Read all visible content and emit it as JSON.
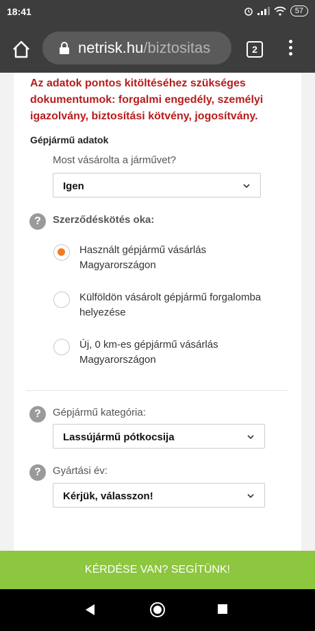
{
  "status_bar": {
    "time": "18:41",
    "battery": "57"
  },
  "browser": {
    "url_domain": "netrisk.hu",
    "url_path": "/biztositas",
    "tab_count": "2"
  },
  "notice": "Az adatok pontos kitöltéséhez szükséges dokumentumok: forgalmi engedély, személyi igazolvány, biztosítási kötvény, jogosítvány.",
  "section_title": "Gépjármű adatok",
  "purchase_question": {
    "label": "Most vásárolta a járművet?",
    "value": "Igen"
  },
  "contract_reason": {
    "label": "Szerződéskötés oka:",
    "options": [
      {
        "label": "Használt gépjármű vásárlás Magyarországon",
        "selected": true
      },
      {
        "label": "Külföldön vásárolt gépjármű forgalomba helyezése",
        "selected": false
      },
      {
        "label": "Új, 0 km-es gépjármű vásárlás Magyarországon",
        "selected": false
      }
    ]
  },
  "vehicle_category": {
    "label": "Gépjármű kategória:",
    "value": "Lassújármű pótkocsija"
  },
  "manufacture_year": {
    "label": "Gyártási év:",
    "value": "Kérjük, válasszon!"
  },
  "cta": "KÉRDÉSE VAN? SEGÍTÜNK!",
  "colors": {
    "accent": "#f47a20",
    "cta": "#8dc63f",
    "notice": "#b71c1c"
  }
}
